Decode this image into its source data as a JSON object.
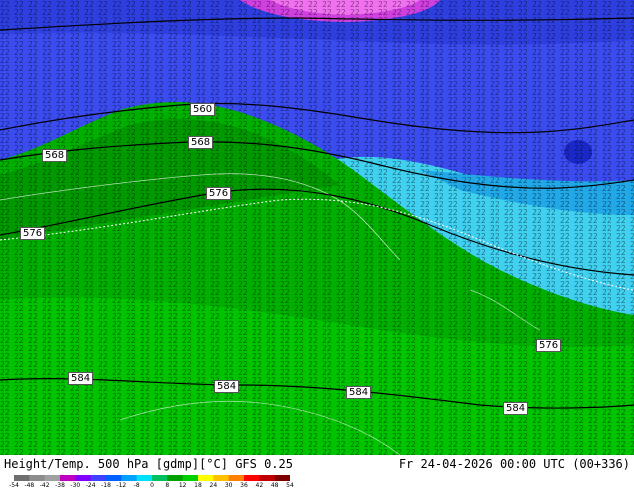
{
  "map": {
    "contour_labels": [
      {
        "id": "560-a",
        "text": "560"
      },
      {
        "id": "568-a",
        "text": "568"
      },
      {
        "id": "568-b",
        "text": "568"
      },
      {
        "id": "576-a",
        "text": "576"
      },
      {
        "id": "576-b",
        "text": "576"
      },
      {
        "id": "576-c",
        "text": "576"
      },
      {
        "id": "584-a",
        "text": "584"
      },
      {
        "id": "584-b",
        "text": "584"
      },
      {
        "id": "584-c",
        "text": "584"
      },
      {
        "id": "584-d",
        "text": "584"
      }
    ]
  },
  "footer": {
    "title_left": "Height/Temp. 500 hPa [gdmp][°C] GFS 0.25",
    "title_right": "Fr 24-04-2026 00:00 UTC (00+336)"
  },
  "colorbar": {
    "ticks": [
      "-54",
      "-48",
      "-42",
      "-38",
      "-30",
      "-24",
      "-18",
      "-12",
      "-8",
      "0",
      "8",
      "12",
      "18",
      "24",
      "30",
      "36",
      "42",
      "48",
      "54"
    ],
    "colors": [
      "#6e6e6e",
      "#8c8c8c",
      "#a0a0a0",
      "#c000c0",
      "#8000ff",
      "#4040ff",
      "#0060ff",
      "#00a0ff",
      "#00e0ff",
      "#00c060",
      "#00a000",
      "#00d000",
      "#ffff00",
      "#ffc000",
      "#ff8000",
      "#ff0000",
      "#c00000",
      "#800000"
    ]
  }
}
